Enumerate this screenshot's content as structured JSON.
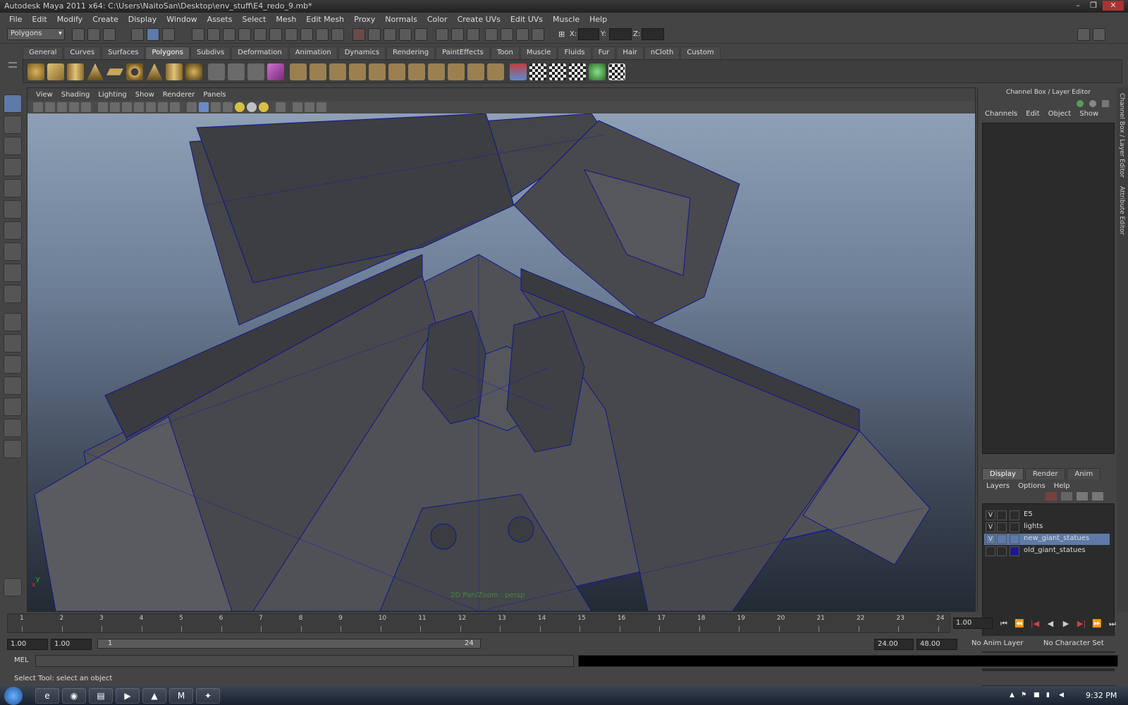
{
  "window": {
    "title": "Autodesk Maya 2011 x64: C:\\Users\\NaitoSan\\Desktop\\env_stuff\\E4_redo_9.mb*"
  },
  "menubar": [
    "File",
    "Edit",
    "Modify",
    "Create",
    "Display",
    "Window",
    "Assets",
    "Select",
    "Mesh",
    "Edit Mesh",
    "Proxy",
    "Normals",
    "Color",
    "Create UVs",
    "Edit UVs",
    "Muscle",
    "Help"
  ],
  "statusline": {
    "mode": "Polygons",
    "x_label": "X:",
    "y_label": "Y:",
    "z_label": "Z:"
  },
  "shelf": {
    "tabs": [
      "General",
      "Curves",
      "Surfaces",
      "Polygons",
      "Subdivs",
      "Deformation",
      "Animation",
      "Dynamics",
      "Rendering",
      "PaintEffects",
      "Toon",
      "Muscle",
      "Fluids",
      "Fur",
      "Hair",
      "nCloth",
      "Custom"
    ],
    "active_tab": "Polygons"
  },
  "viewport": {
    "menu": [
      "View",
      "Shading",
      "Lighting",
      "Show",
      "Renderer",
      "Panels"
    ],
    "status_label": "2D Pan/Zoom : persp",
    "axis_label_x": "x",
    "axis_label_y": "y"
  },
  "channel_box": {
    "title": "Channel Box / Layer Editor",
    "menu": [
      "Channels",
      "Edit",
      "Object",
      "Show"
    ],
    "layer_tabs": [
      "Display",
      "Render",
      "Anim"
    ],
    "active_layer_tab": "Display",
    "layer_menu": [
      "Layers",
      "Options",
      "Help"
    ],
    "layers": [
      {
        "visible": "V",
        "name": "E5",
        "color": "",
        "selected": false
      },
      {
        "visible": "V",
        "name": "lights",
        "color": "",
        "selected": false
      },
      {
        "visible": "V",
        "name": "new_giant_statues",
        "color": "",
        "selected": true
      },
      {
        "visible": "",
        "name": "old_giant_statues",
        "color": "#1a1a8a",
        "selected": false
      }
    ],
    "side_tabs": [
      "Channel Box / Layer Editor",
      "Attribute Editor"
    ]
  },
  "timeslider": {
    "ticks": [
      "1",
      "2",
      "3",
      "4",
      "5",
      "6",
      "7",
      "8",
      "9",
      "10",
      "11",
      "12",
      "13",
      "14",
      "15",
      "16",
      "17",
      "18",
      "19",
      "20",
      "21",
      "22",
      "23",
      "24"
    ],
    "current_time": "1.00"
  },
  "rangebar": {
    "start_time": "1.00",
    "playback_start": "1.00",
    "range_start_label": "1",
    "range_end_label": "24",
    "playback_end": "24.00",
    "end_time": "48.00",
    "anim_layer": "No Anim Layer",
    "character_set": "No Character Set"
  },
  "cmdline": {
    "label": "MEL"
  },
  "helpline": {
    "text": "Select Tool: select an object"
  },
  "taskbar": {
    "clock": "9:32 PM"
  },
  "colors": {
    "wire": "#1a1aa0",
    "selected_layer": "#5d7aa8"
  }
}
